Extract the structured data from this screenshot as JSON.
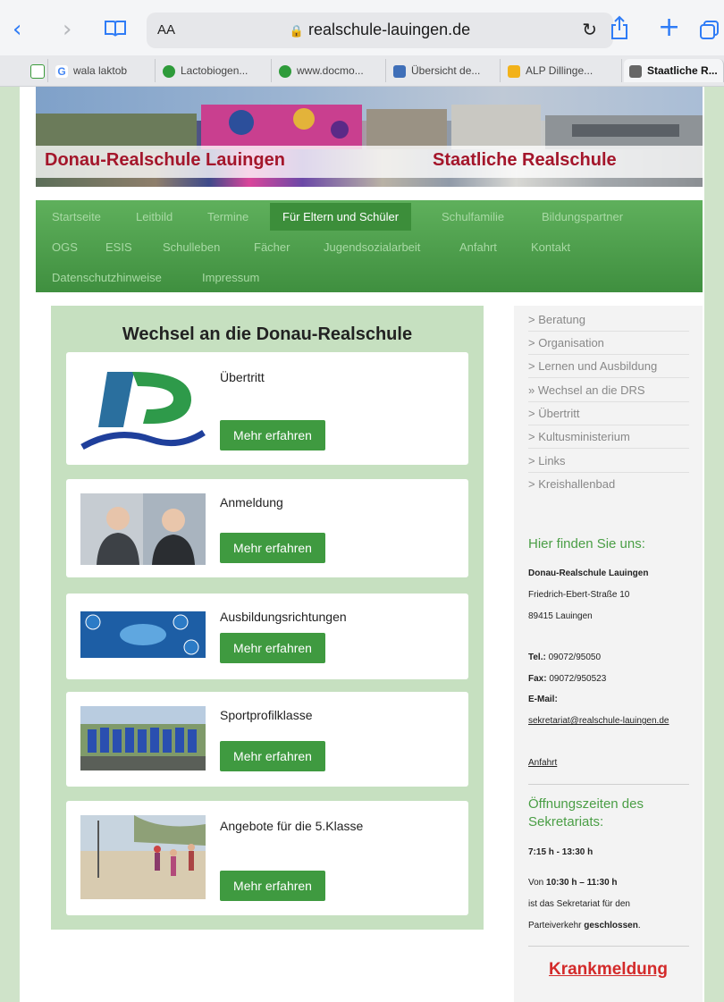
{
  "browser": {
    "aa_label": "AA",
    "url": "realschule-lauingen.de",
    "tabs": [
      {
        "label": "",
        "color": "#3a9b3a"
      },
      {
        "label": "wala laktob",
        "color": "#ffffff"
      },
      {
        "label": "Lactobiogen...",
        "color": "#2e9b3a"
      },
      {
        "label": "www.docmo...",
        "color": "#2e9b3a"
      },
      {
        "label": "Übersicht de...",
        "color": "#3f6fb8"
      },
      {
        "label": "ALP Dillinge...",
        "color": "#f2b21a"
      },
      {
        "label": "Staatliche R...",
        "color": "#666666"
      }
    ]
  },
  "banner": {
    "left_title": "Donau-Realschule Lauingen",
    "right_title": "Staatliche Realschule"
  },
  "menu": {
    "row1": [
      "Startseite",
      "Leitbild",
      "Termine",
      "Für Eltern und Schüler",
      "Schulfamilie",
      "Bildungspartner"
    ],
    "row2": [
      "OGS",
      "ESIS",
      "Schulleben",
      "Fächer",
      "Jugendsozialarbeit",
      "Anfahrt",
      "Kontakt"
    ],
    "row3": [
      "Datenschutzhinweise",
      "Impressum"
    ],
    "active": "Für Eltern und Schüler"
  },
  "main": {
    "title": "Wechsel an die Donau-Realschule",
    "button_label": "Mehr erfahren",
    "cards": [
      {
        "title": "Übertritt"
      },
      {
        "title": "Anmeldung"
      },
      {
        "title": "Ausbildungsrichtungen"
      },
      {
        "title": "Sportprofilklasse"
      },
      {
        "title": "Angebote für die 5.Klasse"
      }
    ]
  },
  "sidebar": {
    "links": [
      "> Beratung",
      "> Organisation",
      "> Lernen und Ausbildung",
      "» Wechsel an die DRS",
      "> Übertritt",
      "> Kultusministerium",
      "> Links",
      "> Kreishallenbad"
    ],
    "find_us_heading": "Hier finden Sie uns:",
    "school_name": "Donau-Realschule Lauingen",
    "street": "Friedrich-Ebert-Straße 10",
    "city": "89415 Lauingen",
    "tel_label": "Tel.:",
    "tel": "09072/95050",
    "fax_label": "Fax:",
    "fax": "09072/950523",
    "email_label": "E-Mail:",
    "email": "sekretariat@realschule-lauingen.de",
    "anfahrt": "Anfahrt",
    "hours_heading": "Öffnungszeiten des Sekretariats:",
    "hours": "7:15 h - 13:30 h",
    "closed_prefix": "Von",
    "closed_time": "10:30 h – 11:30 h",
    "closed_line2": "ist das Sekretariat für den",
    "closed_line3_prefix": "Parteiverkehr",
    "closed_word": "geschlossen",
    "closed_suffix": ".",
    "krankmeldung": "Krankmeldung"
  }
}
